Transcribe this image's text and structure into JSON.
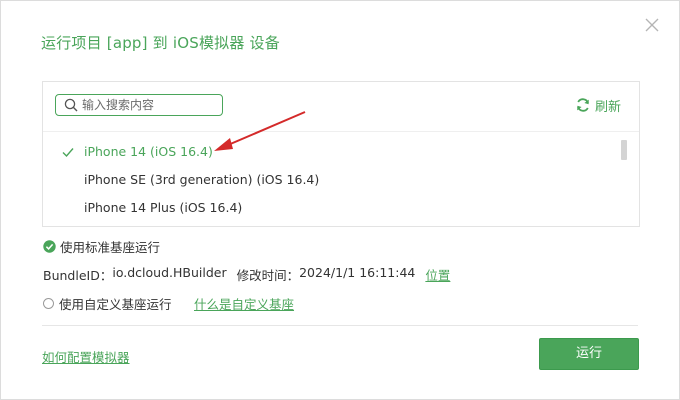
{
  "dialog": {
    "title": "运行项目 [app] 到 iOS模拟器 设备"
  },
  "search": {
    "placeholder": "输入搜索内容",
    "value": ""
  },
  "refresh_label": "刷新",
  "devices": [
    {
      "name": "iPhone 14 (iOS 16.4)",
      "selected": true
    },
    {
      "name": "iPhone SE (3rd generation) (iOS 16.4)",
      "selected": false
    },
    {
      "name": "iPhone 14 Plus (iOS 16.4)",
      "selected": false
    }
  ],
  "options": {
    "standard_label": "使用标准基座运行",
    "standard_checked": true,
    "bundle_label": "BundleID：",
    "bundle_id": "io.dcloud.HBuilder",
    "modified_label": "修改时间：",
    "modified_time": "2024/1/1 16:11:44",
    "location_link": "位置",
    "custom_label": "使用自定义基座运行",
    "custom_checked": false,
    "custom_help_link": "什么是自定义基座"
  },
  "footer": {
    "config_link": "如何配置模拟器",
    "run_button": "运行"
  },
  "colors": {
    "accent": "#4aa55a",
    "annotation_arrow": "#d42a2a"
  }
}
